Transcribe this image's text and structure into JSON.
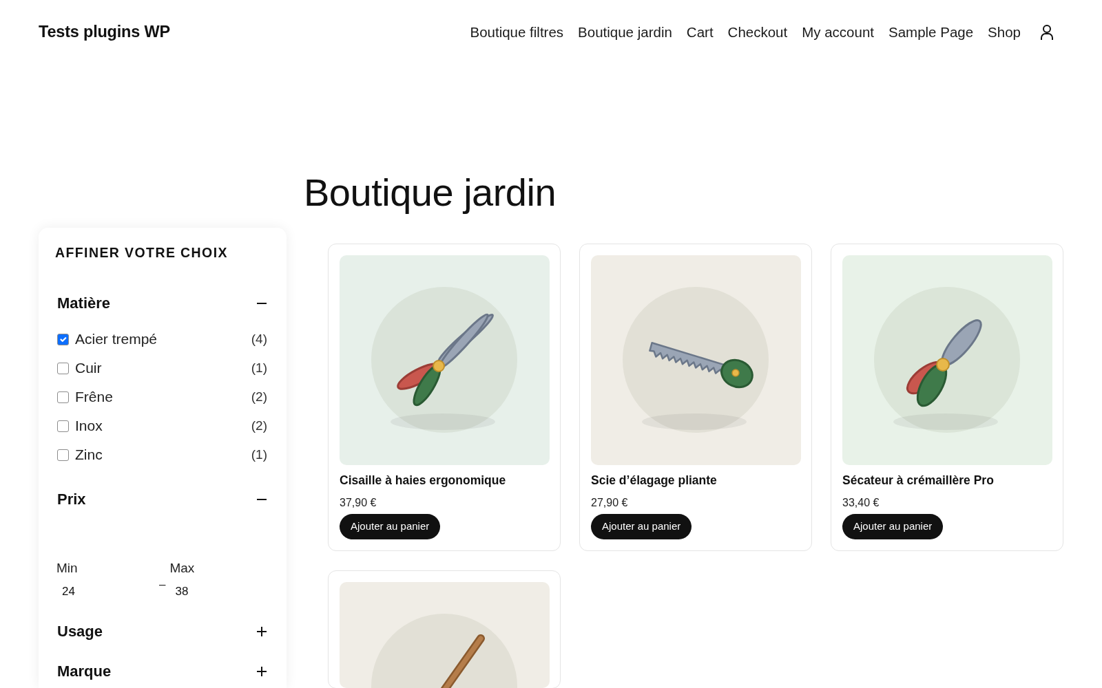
{
  "header": {
    "site_title": "Tests plugins WP",
    "nav": [
      "Boutique filtres",
      "Boutique jardin",
      "Cart",
      "Checkout",
      "My account",
      "Sample Page",
      "Shop"
    ]
  },
  "page_title": "Boutique jardin",
  "filters": {
    "title": "AFFINER VOTRE CHOIX",
    "groups": [
      {
        "kind": "checklist",
        "label": "Matière",
        "expanded": true,
        "options": [
          {
            "label": "Acier trempé",
            "count": "(4)",
            "checked": true
          },
          {
            "label": "Cuir",
            "count": "(1)",
            "checked": false
          },
          {
            "label": "Frêne",
            "count": "(2)",
            "checked": false
          },
          {
            "label": "Inox",
            "count": "(2)",
            "checked": false
          },
          {
            "label": "Zinc",
            "count": "(1)",
            "checked": false
          }
        ]
      },
      {
        "kind": "price",
        "label": "Prix",
        "expanded": true,
        "min": {
          "label": "Min",
          "value": "24"
        },
        "separator": "–",
        "max": {
          "label": "Max",
          "value": "38"
        }
      },
      {
        "label": "Usage",
        "expanded": false
      },
      {
        "label": "Marque",
        "expanded": false
      }
    ]
  },
  "products": [
    {
      "kind": "hedge-shears",
      "color": "#e7f0ea",
      "name": "Cisaille à haies ergonomique",
      "price": "37,90 €",
      "button": "Ajouter au panier"
    },
    {
      "kind": "saw",
      "color": "#f0ede6",
      "name": "Scie d’élagage pliante",
      "price": "27,90 €",
      "button": "Ajouter au panier"
    },
    {
      "kind": "pruner",
      "color": "#e8f2e8",
      "name": "Sécateur à crémaillère Pro",
      "price": "33,40 €",
      "button": "Ajouter au panier"
    },
    {
      "kind": "handle",
      "color": "#f0ede6"
    }
  ]
}
